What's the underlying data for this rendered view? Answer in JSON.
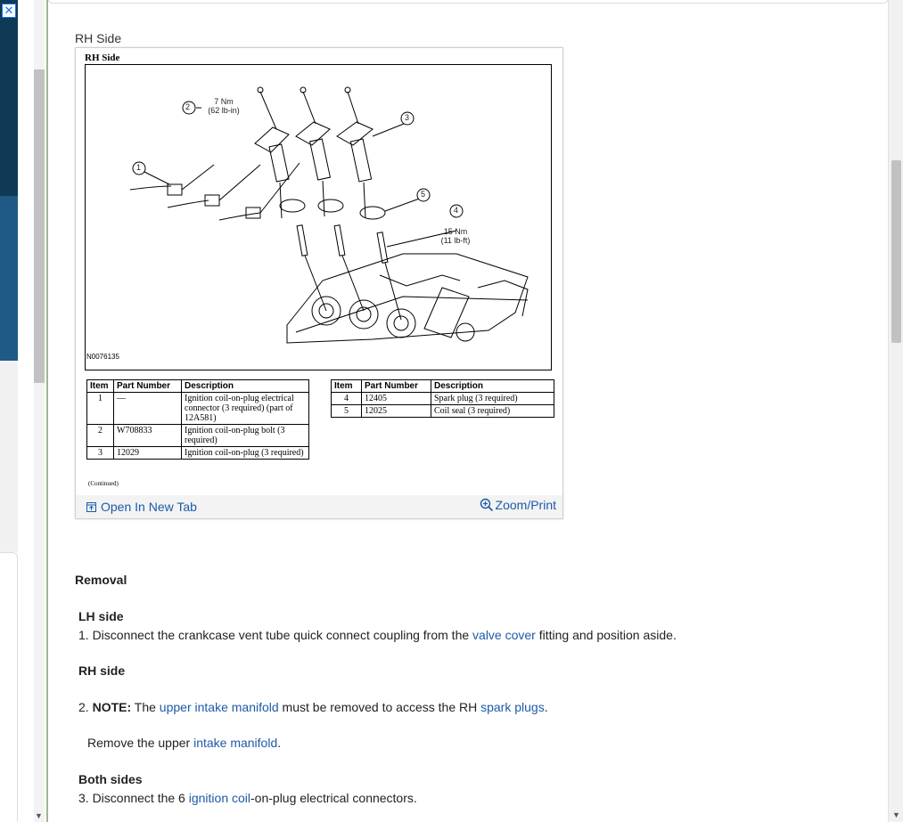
{
  "ad": {
    "close_glyph": "✕"
  },
  "section_caption": "RH Side",
  "figure": {
    "title": "RH Side",
    "code": "N0076135",
    "callouts": {
      "c1": "1",
      "c2": "2",
      "c3": "3",
      "c4": "4",
      "c5": "5",
      "torque2a": "7 Nm",
      "torque2b": "(62 lb-in)",
      "torque4a": "15 Nm",
      "torque4b": "(11 lb-ft)"
    },
    "table_headers": {
      "item": "Item",
      "part_number": "Part Number",
      "description": "Description"
    },
    "table1": [
      {
        "item": "1",
        "part": "—",
        "desc": "Ignition coil-on-plug electrical connector (3 required) (part of 12A581)"
      },
      {
        "item": "2",
        "part": "W708833",
        "desc": "Ignition coil-on-plug bolt (3 required)"
      },
      {
        "item": "3",
        "part": "12029",
        "desc": "Ignition coil-on-plug (3 required)"
      }
    ],
    "table2": [
      {
        "item": "4",
        "part": "12405",
        "desc": "Spark plug (3 required)"
      },
      {
        "item": "5",
        "part": "12025",
        "desc": "Coil seal (3 required)"
      }
    ],
    "continued": "(Continued)",
    "open_tab_label": "Open In New Tab",
    "zoom_label": "Zoom/Print"
  },
  "removal": {
    "heading": "Removal",
    "lh_heading": "LH side",
    "step1_pre": "1. Disconnect the crankcase vent tube quick connect coupling from the ",
    "step1_link": "valve cover",
    "step1_post": " fitting and position aside.",
    "rh_heading": "RH side",
    "step2_num": "2. ",
    "step2_note": "NOTE:",
    "step2_pre": " The ",
    "step2_link1": "upper intake manifold",
    "step2_mid": " must be removed to access the RH ",
    "step2_link2": "spark plugs",
    "step2_end": ".",
    "step2b_pre": "Remove the upper ",
    "step2b_link": "intake manifold",
    "step2b_end": ".",
    "both_heading": "Both sides",
    "step3_pre": "3. Disconnect the 6 ",
    "step3_link": "ignition coil",
    "step3_post": "-on-plug electrical connectors."
  }
}
